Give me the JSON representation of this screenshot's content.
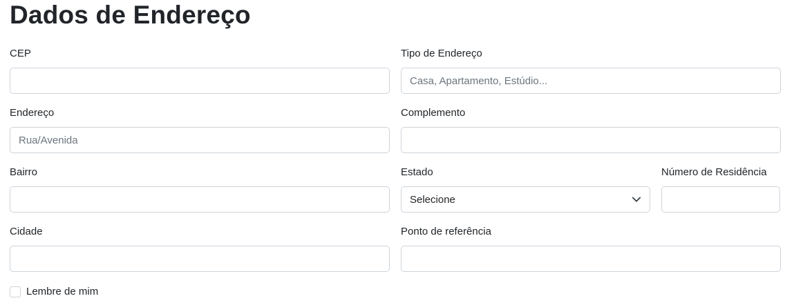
{
  "page": {
    "title": "Dados de Endereço"
  },
  "form": {
    "cep": {
      "label": "CEP",
      "value": "",
      "placeholder": ""
    },
    "tipo_endereco": {
      "label": "Tipo de Endereço",
      "value": "",
      "placeholder": "Casa, Apartamento, Estúdio..."
    },
    "endereco": {
      "label": "Endereço",
      "value": "",
      "placeholder": "Rua/Avenida"
    },
    "complemento": {
      "label": "Complemento",
      "value": "",
      "placeholder": ""
    },
    "bairro": {
      "label": "Bairro",
      "value": "",
      "placeholder": ""
    },
    "estado": {
      "label": "Estado",
      "selected": "Selecione"
    },
    "numero_residencia": {
      "label": "Número de Residência",
      "value": "",
      "placeholder": ""
    },
    "cidade": {
      "label": "Cidade",
      "value": "",
      "placeholder": ""
    },
    "ponto_referencia": {
      "label": "Ponto de referência",
      "value": "",
      "placeholder": ""
    },
    "lembre_de_mim": {
      "label": "Lembre de mim",
      "checked": false
    }
  }
}
